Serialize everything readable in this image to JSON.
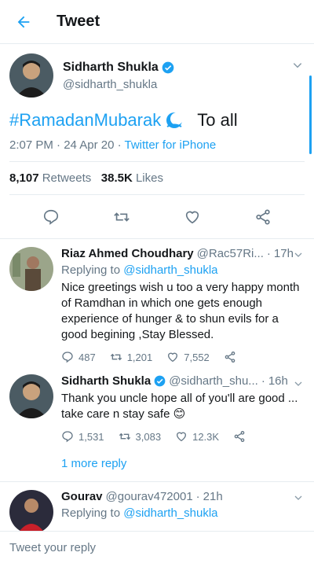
{
  "header": {
    "title": "Tweet",
    "back_icon": "arrow-left-icon"
  },
  "tweet": {
    "name": "Sidharth Shukla",
    "handle": "@sidharth_shukla",
    "hashtag": "#RamadanMubarak",
    "text_after": "To all",
    "time": "2:07 PM",
    "date": "24 Apr 20",
    "source": "Twitter for iPhone",
    "retweets_count": "8,107",
    "retweets_label": "Retweets",
    "likes_count": "38.5K",
    "likes_label": "Likes"
  },
  "replies": [
    {
      "name": "Riaz Ahmed Choudhary",
      "handle": "@Rac57Ri...",
      "time": "17h",
      "replying_label": "Replying to",
      "replying_to": "@sidharth_shukla",
      "text": "Nice greetings wish u too a very happy month of Ramdhan in which one gets enough experience of hunger & to shun evils for a good begining ,Stay Blessed.",
      "replies": "487",
      "retweets": "1,201",
      "likes": "7,552"
    },
    {
      "name": "Sidharth Shukla",
      "handle": "@sidharth_shu...",
      "time": "16h",
      "text": "Thank you uncle hope all of you'll are good ... take care n stay safe 😊",
      "replies": "1,531",
      "retweets": "3,083",
      "likes": "12.3K",
      "more_replies": "1 more reply"
    },
    {
      "name": "Gourav",
      "handle": "@gourav472001",
      "time": "21h",
      "replying_label": "Replying to",
      "replying_to": "@sidharth_shukla"
    }
  ],
  "composer": {
    "placeholder": "Tweet your reply"
  },
  "colors": {
    "accent": "#1da1f2",
    "secondary": "#657786"
  }
}
